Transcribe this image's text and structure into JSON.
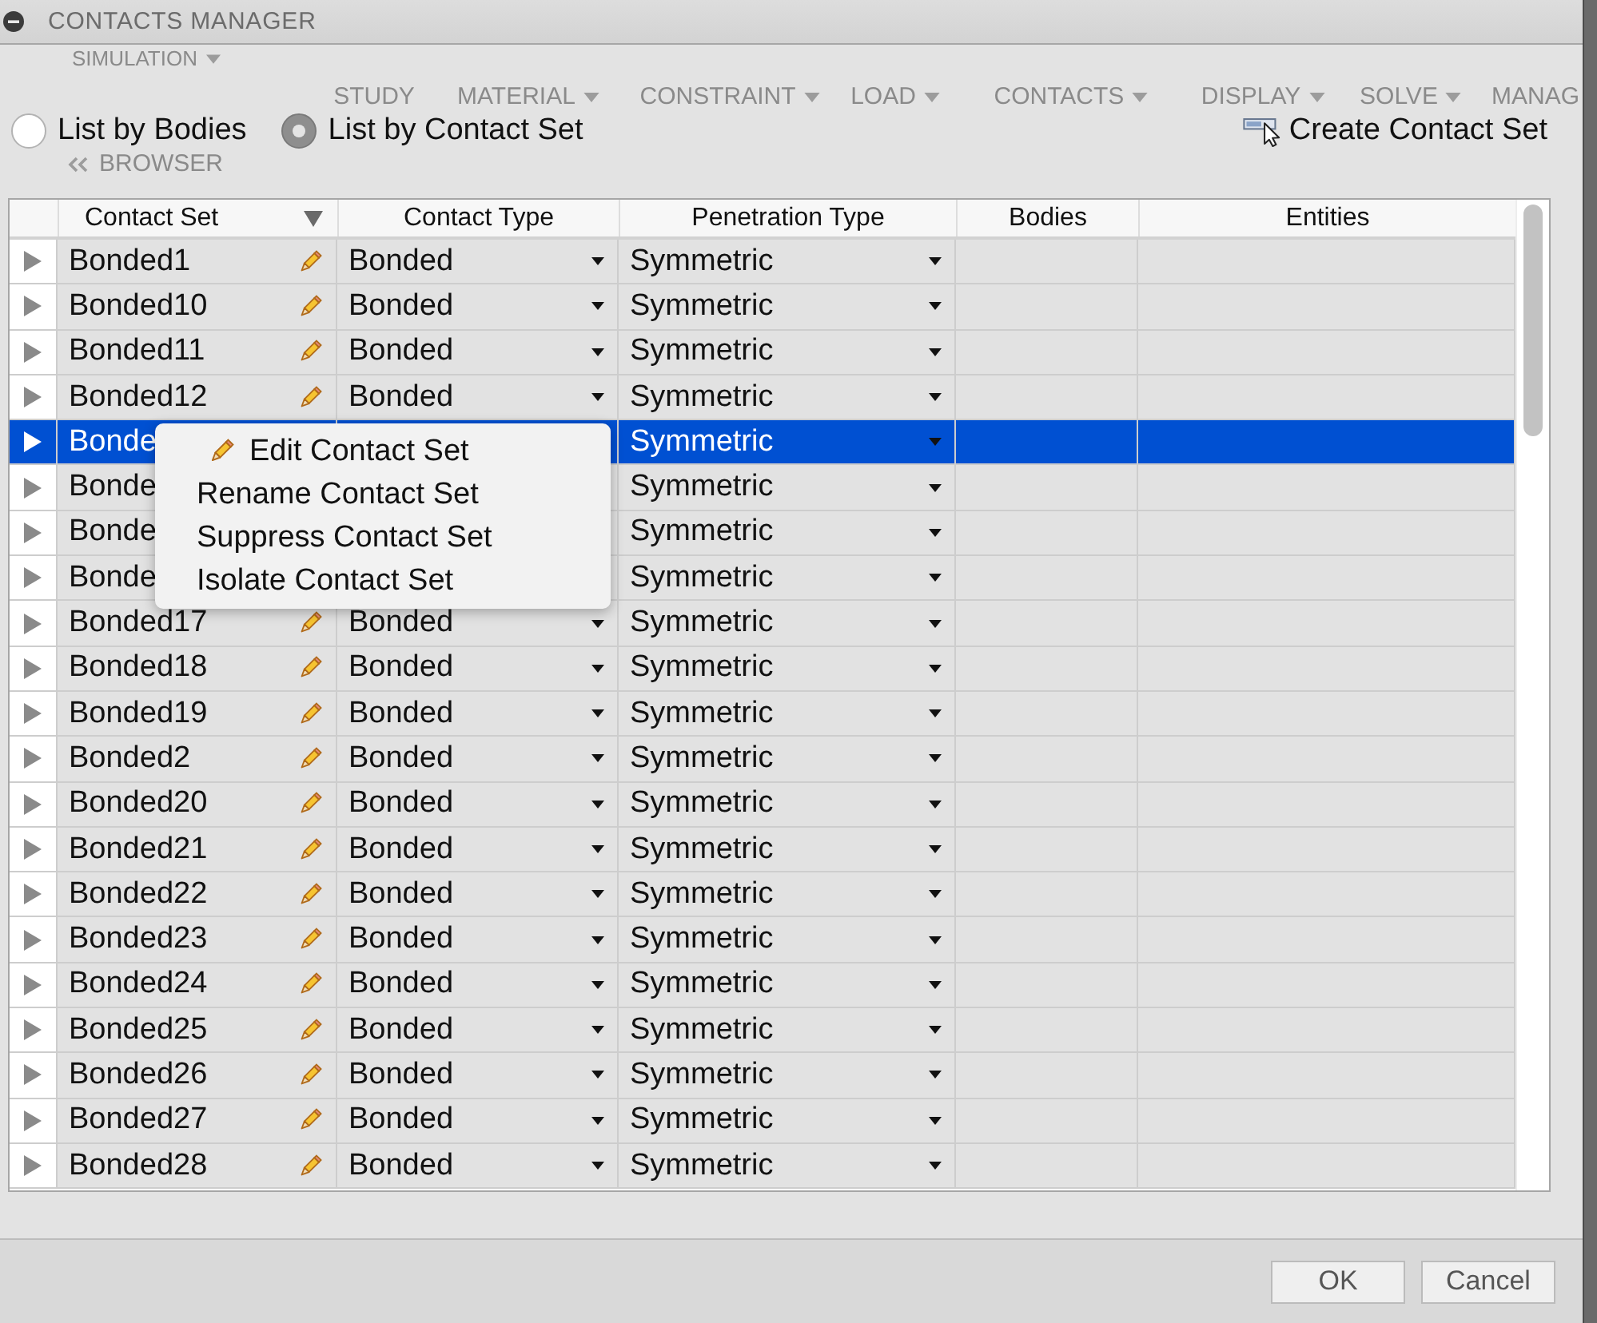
{
  "window": {
    "title": "CONTACTS MANAGER"
  },
  "background_app": {
    "ribbon_tab": {
      "label": "SIMULATION",
      "has_menu": true
    },
    "toolbar": [
      {
        "label": "STUDY",
        "has_menu": false
      },
      {
        "label": "MATERIAL",
        "has_menu": true
      },
      {
        "label": "CONSTRAINT",
        "has_menu": true
      },
      {
        "label": "LOAD",
        "has_menu": true
      },
      {
        "label": "CONTACTS",
        "has_menu": true
      },
      {
        "label": "DISPLAY",
        "has_menu": true
      },
      {
        "label": "SOLVE",
        "has_menu": true
      },
      {
        "label": "MANAG",
        "has_menu": false
      }
    ],
    "browser": {
      "label": "BROWSER"
    }
  },
  "view_options": [
    {
      "label": "List by Bodies",
      "selected": false
    },
    {
      "label": "List by Contact Set",
      "selected": true
    }
  ],
  "create_button": {
    "label": "Create Contact Set"
  },
  "table": {
    "columns": [
      {
        "label": "Contact Set",
        "sorted": true
      },
      {
        "label": "Contact Type",
        "sorted": false
      },
      {
        "label": "Penetration Type",
        "sorted": false
      },
      {
        "label": "Bodies",
        "sorted": false
      },
      {
        "label": "Entities",
        "sorted": false
      }
    ],
    "rows": [
      {
        "name": "Bonded1",
        "edit_icon": true,
        "contact_type": "Bonded",
        "penetration_type": "Symmetric",
        "selected": false
      },
      {
        "name": "Bonded10",
        "edit_icon": true,
        "contact_type": "Bonded",
        "penetration_type": "Symmetric",
        "selected": false
      },
      {
        "name": "Bonded11",
        "edit_icon": true,
        "contact_type": "Bonded",
        "penetration_type": "Symmetric",
        "selected": false
      },
      {
        "name": "Bonded12",
        "edit_icon": true,
        "contact_type": "Bonded",
        "penetration_type": "Symmetric",
        "selected": false
      },
      {
        "name": "Bonde",
        "penetration_type": "Symmetric",
        "selected": true
      },
      {
        "name": "Bonde",
        "penetration_type": "Symmetric",
        "selected": false
      },
      {
        "name": "Bonde",
        "penetration_type": "Symmetric",
        "selected": false
      },
      {
        "name": "Bonde",
        "penetration_type": "Symmetric",
        "selected": false
      },
      {
        "name": "Bonded17",
        "edit_icon": true,
        "contact_type": "Bonded",
        "penetration_type": "Symmetric",
        "selected": false
      },
      {
        "name": "Bonded18",
        "edit_icon": true,
        "contact_type": "Bonded",
        "penetration_type": "Symmetric",
        "selected": false
      },
      {
        "name": "Bonded19",
        "edit_icon": true,
        "contact_type": "Bonded",
        "penetration_type": "Symmetric",
        "selected": false
      },
      {
        "name": "Bonded2",
        "edit_icon": true,
        "contact_type": "Bonded",
        "penetration_type": "Symmetric",
        "selected": false
      },
      {
        "name": "Bonded20",
        "edit_icon": true,
        "contact_type": "Bonded",
        "penetration_type": "Symmetric",
        "selected": false
      },
      {
        "name": "Bonded21",
        "edit_icon": true,
        "contact_type": "Bonded",
        "penetration_type": "Symmetric",
        "selected": false
      },
      {
        "name": "Bonded22",
        "edit_icon": true,
        "contact_type": "Bonded",
        "penetration_type": "Symmetric",
        "selected": false
      },
      {
        "name": "Bonded23",
        "edit_icon": true,
        "contact_type": "Bonded",
        "penetration_type": "Symmetric",
        "selected": false
      },
      {
        "name": "Bonded24",
        "edit_icon": true,
        "contact_type": "Bonded",
        "penetration_type": "Symmetric",
        "selected": false
      },
      {
        "name": "Bonded25",
        "edit_icon": true,
        "contact_type": "Bonded",
        "penetration_type": "Symmetric",
        "selected": false
      },
      {
        "name": "Bonded26",
        "edit_icon": true,
        "contact_type": "Bonded",
        "penetration_type": "Symmetric",
        "selected": false
      },
      {
        "name": "Bonded27",
        "edit_icon": true,
        "contact_type": "Bonded",
        "penetration_type": "Symmetric",
        "selected": false
      },
      {
        "name": "Bonded28",
        "edit_icon": true,
        "contact_type": "Bonded",
        "penetration_type": "Symmetric",
        "selected": false
      }
    ]
  },
  "context_menu": {
    "items": [
      {
        "label": "Edit Contact Set",
        "has_icon": true
      },
      {
        "label": "Rename Contact Set",
        "has_icon": false
      },
      {
        "label": "Suppress Contact Set",
        "has_icon": false
      },
      {
        "label": "Isolate Contact Set",
        "has_icon": false
      }
    ]
  },
  "buttons": [
    {
      "label": "OK"
    },
    {
      "label": "Cancel"
    }
  ]
}
